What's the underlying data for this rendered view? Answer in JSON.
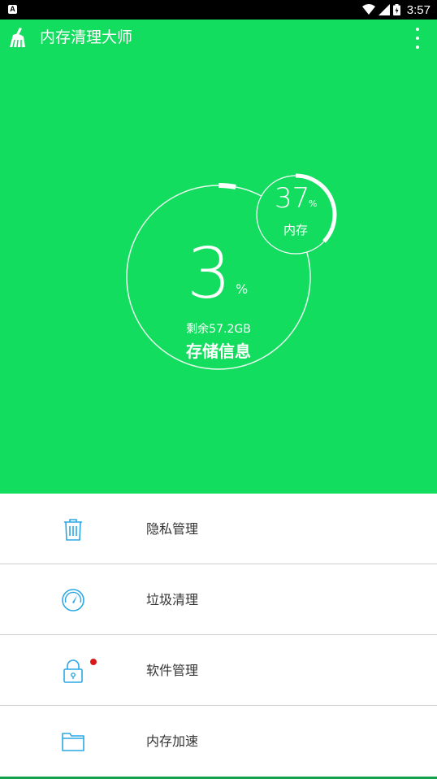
{
  "status_bar": {
    "time": "3:57",
    "notification_icon": "A"
  },
  "toolbar": {
    "title": "内存清理大师",
    "app_icon": "broom-icon",
    "more_icon": "more-vert-icon"
  },
  "storage": {
    "percent": "3",
    "percent_sign": "%",
    "remaining": "剩余57.2GB",
    "label": "存储信息",
    "used_fraction": 0.03
  },
  "memory": {
    "percent": "37",
    "percent_sign": "%",
    "label": "内存",
    "used_fraction": 0.37
  },
  "menu": [
    {
      "label": "隐私管理",
      "icon": "trash-bin-icon",
      "badge": false
    },
    {
      "label": "垃圾清理",
      "icon": "gauge-icon",
      "badge": false
    },
    {
      "label": "软件管理",
      "icon": "lock-icon",
      "badge": true
    },
    {
      "label": "内存加速",
      "icon": "folder-icon",
      "badge": false
    }
  ],
  "colors": {
    "brand_green": "#12dd5e",
    "icon_blue": "#2aa8e6",
    "badge_red": "#d81a1a"
  }
}
